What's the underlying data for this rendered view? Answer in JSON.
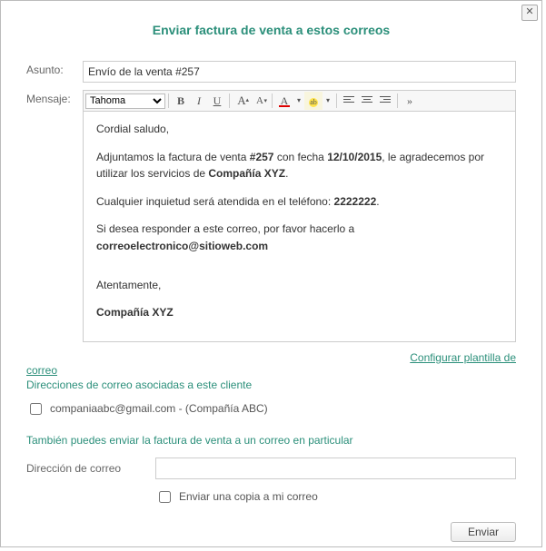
{
  "dialog": {
    "title": "Enviar factura de venta a estos correos",
    "close_glyph": "✕"
  },
  "subject": {
    "label": "Asunto:",
    "value": "Envío de la venta #257"
  },
  "message": {
    "label": "Mensaje:",
    "font_options": [
      "Tahoma"
    ],
    "font_selected": "Tahoma",
    "body": {
      "greeting": "Cordial saludo,",
      "line1_a": "Adjuntamos la factura de venta ",
      "line1_num": "#257",
      "line1_b": " con fecha ",
      "line1_date": "12/10/2015",
      "line1_c": ", le agradecemos por utilizar los servicios de ",
      "line1_company": "Compañía XYZ",
      "line1_d": ".",
      "line2_a": "Cualquier inquietud será atendida en el teléfono: ",
      "line2_phone": "2222222",
      "line2_b": ".",
      "line3_a": "Si desea responder a este correo, por favor hacerlo a ",
      "line3_email": "correoelectronico@sitioweb.com",
      "signoff": "Atentamente,",
      "signature": "Compañía XYZ"
    }
  },
  "links": {
    "configure_a": "Configurar plantilla de",
    "configure_b": "correo"
  },
  "recipients": {
    "associated_label": "Direcciones de correo asociadas a este cliente",
    "items": [
      {
        "email": "companiaabc@gmail.com",
        "name": "Compañía ABC",
        "checked": false
      }
    ],
    "separator": " - (",
    "close": ")"
  },
  "extra": {
    "hint": "También puedes enviar la factura de venta a un correo en particular",
    "address_label": "Dirección de correo",
    "address_value": "",
    "copy_me_label": "Enviar una copia a mi correo",
    "copy_me_checked": false
  },
  "footer": {
    "send_label": "Enviar"
  },
  "toolbar": {
    "bold": "B",
    "italic": "I",
    "underline": "U",
    "incA": "A",
    "decA": "A",
    "fontcolorA": "A",
    "hiliteAb": "ab",
    "dropdown": "▾",
    "dbl": "»"
  }
}
